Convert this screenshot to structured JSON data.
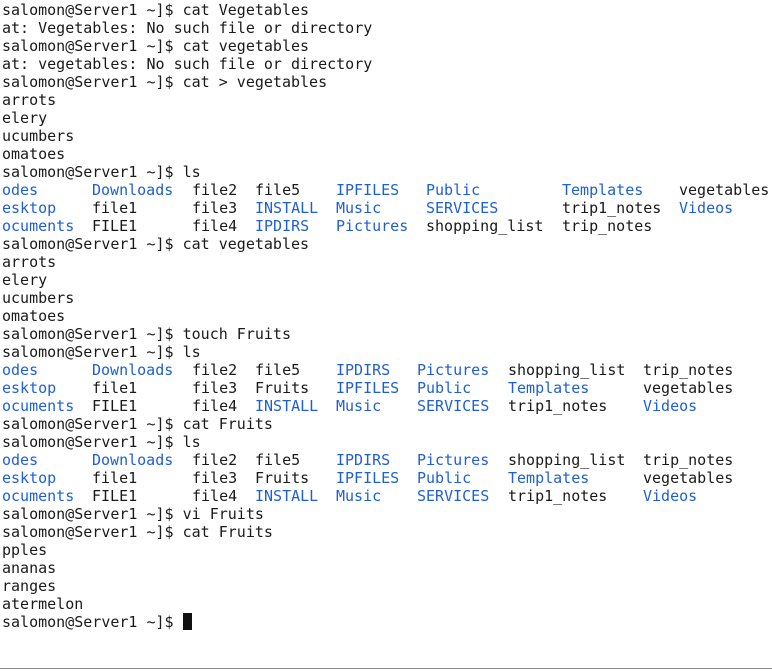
{
  "terminal": {
    "prompt": "salomon@Server1 ~]$ ",
    "lines": [
      {
        "kind": "cmd",
        "text": "cat Vegetables"
      },
      {
        "kind": "out",
        "text": "at: Vegetables: No such file or directory"
      },
      {
        "kind": "cmd",
        "text": "cat vegetables"
      },
      {
        "kind": "out",
        "text": "at: vegetables: No such file or directory"
      },
      {
        "kind": "cmd",
        "text": "cat > vegetables"
      },
      {
        "kind": "out",
        "text": "arrots"
      },
      {
        "kind": "out",
        "text": "elery"
      },
      {
        "kind": "out",
        "text": "ucumbers"
      },
      {
        "kind": "out",
        "text": "omatoes"
      },
      {
        "kind": "cmd",
        "text": "ls"
      },
      {
        "kind": "ls",
        "cols": [
          0,
          10,
          21,
          28,
          37,
          47,
          62,
          75
        ],
        "cells": [
          {
            "t": "odes",
            "d": true
          },
          {
            "t": "Downloads",
            "d": true
          },
          {
            "t": "file2",
            "d": false
          },
          {
            "t": "file5",
            "d": false
          },
          {
            "t": "IPFILES",
            "d": true
          },
          {
            "t": "Public",
            "d": true
          },
          {
            "t": "Templates",
            "d": true
          },
          {
            "t": "vegetables",
            "d": false
          }
        ]
      },
      {
        "kind": "ls",
        "cols": [
          0,
          10,
          21,
          28,
          37,
          47,
          62,
          75
        ],
        "cells": [
          {
            "t": "esktop",
            "d": true
          },
          {
            "t": "file1",
            "d": false
          },
          {
            "t": "file3",
            "d": false
          },
          {
            "t": "INSTALL",
            "d": true
          },
          {
            "t": "Music",
            "d": true
          },
          {
            "t": "SERVICES",
            "d": true
          },
          {
            "t": "trip1_notes",
            "d": false
          },
          {
            "t": "Videos",
            "d": true
          }
        ]
      },
      {
        "kind": "ls",
        "cols": [
          0,
          10,
          21,
          28,
          37,
          47,
          62
        ],
        "cells": [
          {
            "t": "ocuments",
            "d": true
          },
          {
            "t": "FILE1",
            "d": false
          },
          {
            "t": "file4",
            "d": false
          },
          {
            "t": "IPDIRS",
            "d": true
          },
          {
            "t": "Pictures",
            "d": true
          },
          {
            "t": "shopping_list",
            "d": false
          },
          {
            "t": "trip_notes",
            "d": false
          }
        ]
      },
      {
        "kind": "cmd",
        "text": "cat vegetables"
      },
      {
        "kind": "out",
        "text": "arrots"
      },
      {
        "kind": "out",
        "text": "elery"
      },
      {
        "kind": "out",
        "text": "ucumbers"
      },
      {
        "kind": "out",
        "text": "omatoes"
      },
      {
        "kind": "cmd",
        "text": "touch Fruits"
      },
      {
        "kind": "cmd",
        "text": "ls"
      },
      {
        "kind": "ls",
        "cols": [
          0,
          10,
          21,
          28,
          37,
          46,
          56,
          71
        ],
        "cells": [
          {
            "t": "odes",
            "d": true
          },
          {
            "t": "Downloads",
            "d": true
          },
          {
            "t": "file2",
            "d": false
          },
          {
            "t": "file5",
            "d": false
          },
          {
            "t": "IPDIRS",
            "d": true
          },
          {
            "t": "Pictures",
            "d": true
          },
          {
            "t": "shopping_list",
            "d": false
          },
          {
            "t": "trip_notes",
            "d": false
          }
        ]
      },
      {
        "kind": "ls",
        "cols": [
          0,
          10,
          21,
          28,
          37,
          46,
          56,
          71
        ],
        "cells": [
          {
            "t": "esktop",
            "d": true
          },
          {
            "t": "file1",
            "d": false
          },
          {
            "t": "file3",
            "d": false
          },
          {
            "t": "Fruits",
            "d": false
          },
          {
            "t": "IPFILES",
            "d": true
          },
          {
            "t": "Public",
            "d": true
          },
          {
            "t": "Templates",
            "d": true
          },
          {
            "t": "vegetables",
            "d": false
          }
        ]
      },
      {
        "kind": "ls",
        "cols": [
          0,
          10,
          21,
          28,
          37,
          46,
          56,
          71
        ],
        "cells": [
          {
            "t": "ocuments",
            "d": true
          },
          {
            "t": "FILE1",
            "d": false
          },
          {
            "t": "file4",
            "d": false
          },
          {
            "t": "INSTALL",
            "d": true
          },
          {
            "t": "Music",
            "d": true
          },
          {
            "t": "SERVICES",
            "d": true
          },
          {
            "t": "trip1_notes",
            "d": false
          },
          {
            "t": "Videos",
            "d": true
          }
        ]
      },
      {
        "kind": "cmd",
        "text": "cat Fruits"
      },
      {
        "kind": "cmd",
        "text": "ls"
      },
      {
        "kind": "ls",
        "cols": [
          0,
          10,
          21,
          28,
          37,
          46,
          56,
          71
        ],
        "cells": [
          {
            "t": "odes",
            "d": true
          },
          {
            "t": "Downloads",
            "d": true
          },
          {
            "t": "file2",
            "d": false
          },
          {
            "t": "file5",
            "d": false
          },
          {
            "t": "IPDIRS",
            "d": true
          },
          {
            "t": "Pictures",
            "d": true
          },
          {
            "t": "shopping_list",
            "d": false
          },
          {
            "t": "trip_notes",
            "d": false
          }
        ]
      },
      {
        "kind": "ls",
        "cols": [
          0,
          10,
          21,
          28,
          37,
          46,
          56,
          71
        ],
        "cells": [
          {
            "t": "esktop",
            "d": true
          },
          {
            "t": "file1",
            "d": false
          },
          {
            "t": "file3",
            "d": false
          },
          {
            "t": "Fruits",
            "d": false
          },
          {
            "t": "IPFILES",
            "d": true
          },
          {
            "t": "Public",
            "d": true
          },
          {
            "t": "Templates",
            "d": true
          },
          {
            "t": "vegetables",
            "d": false
          }
        ]
      },
      {
        "kind": "ls",
        "cols": [
          0,
          10,
          21,
          28,
          37,
          46,
          56,
          71
        ],
        "cells": [
          {
            "t": "ocuments",
            "d": true
          },
          {
            "t": "FILE1",
            "d": false
          },
          {
            "t": "file4",
            "d": false
          },
          {
            "t": "INSTALL",
            "d": true
          },
          {
            "t": "Music",
            "d": true
          },
          {
            "t": "SERVICES",
            "d": true
          },
          {
            "t": "trip1_notes",
            "d": false
          },
          {
            "t": "Videos",
            "d": true
          }
        ]
      },
      {
        "kind": "cmd",
        "text": "vi Fruits"
      },
      {
        "kind": "cmd",
        "text": "cat Fruits"
      },
      {
        "kind": "out",
        "text": "pples"
      },
      {
        "kind": "out",
        "text": "ananas"
      },
      {
        "kind": "out",
        "text": "ranges"
      },
      {
        "kind": "out",
        "text": "atermelon"
      },
      {
        "kind": "cursor",
        "text": ""
      }
    ]
  },
  "colors": {
    "background": "#ffffff",
    "text": "#1a1a1a",
    "directory": "#1f5fd6",
    "cursor": "#111111"
  }
}
